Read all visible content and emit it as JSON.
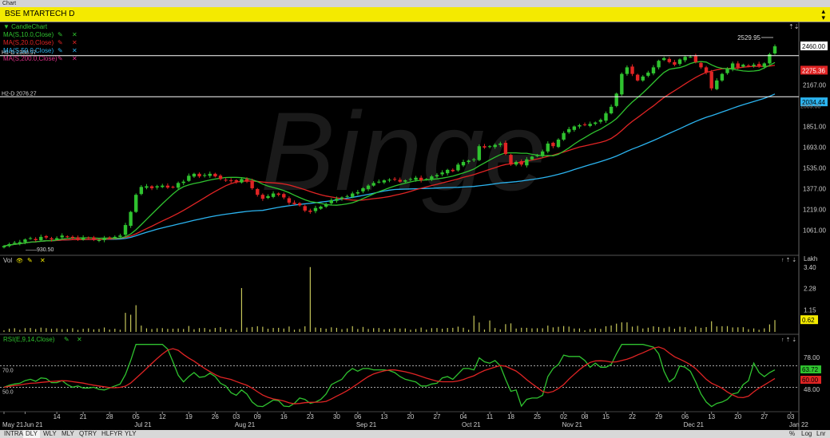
{
  "window": {
    "title": "Chart",
    "chart_title": "BSE MTARTECH D"
  },
  "panels": {
    "price": {
      "label": "CandleChart",
      "indicators": [
        {
          "label": "MA(S,10.0,Close)",
          "color": "#2fc22f"
        },
        {
          "label": "MA(S,20.0,Close)",
          "color": "#e02424"
        },
        {
          "label": "MA(S,50.0,Close)",
          "color": "#2bb4f0"
        },
        {
          "label": "MA(S,200.0,Close)",
          "color": "#e0308a"
        }
      ],
      "hline_labels": [
        "H1-D 2388.97",
        "H2-D 2076.27"
      ],
      "annotations": {
        "high": "2529.95",
        "low": "930.50"
      },
      "price_tags": [
        "2460.00",
        "2275.36",
        "2034.44"
      ]
    },
    "volume": {
      "label": "Vol",
      "unit": "Lakh",
      "last_tag": "0.62"
    },
    "rsi": {
      "label": "RSI(E,9,14,Close)",
      "levels": [
        "70.0",
        "50.0"
      ],
      "tags": [
        "63.72",
        "60.00"
      ]
    }
  },
  "bottom_tabs": [
    "INTRA",
    "DLY",
    "WLY",
    "MLY",
    "QTRY",
    "HLFYR",
    "YLY"
  ],
  "bottom_right": [
    "%",
    "Log",
    "Lnr"
  ],
  "watermark": "Binge",
  "chart_data": {
    "type": "candlestick",
    "title": "BSE MTARTECH D",
    "price_axis": {
      "ticks": [
        "2460.00",
        "2167.00",
        "2009.00",
        "1851.00",
        "1693.00",
        "1535.00",
        "1377.00",
        "1219.00",
        "1061.00"
      ],
      "range": [
        900,
        2600
      ]
    },
    "volume_axis": {
      "ticks": [
        "3.40",
        "2.28",
        "1.15"
      ],
      "unit": "Lakh"
    },
    "rsi_axis": {
      "ticks": [
        "78.00",
        "48.00"
      ],
      "levels": [
        70,
        50
      ]
    },
    "x_ticks": [
      {
        "day": "",
        "month": "May 21",
        "i": 0
      },
      {
        "day": "",
        "month": "Jun 21",
        "i": 4
      },
      {
        "day": "14",
        "month": "",
        "i": 10
      },
      {
        "day": "21",
        "month": "",
        "i": 15
      },
      {
        "day": "28",
        "month": "",
        "i": 20
      },
      {
        "day": "05",
        "month": "Jul 21",
        "i": 25
      },
      {
        "day": "12",
        "month": "",
        "i": 30
      },
      {
        "day": "19",
        "month": "",
        "i": 35
      },
      {
        "day": "26",
        "month": "",
        "i": 40
      },
      {
        "day": "03",
        "month": "Aug 21",
        "i": 44
      },
      {
        "day": "09",
        "month": "",
        "i": 48
      },
      {
        "day": "16",
        "month": "",
        "i": 53
      },
      {
        "day": "23",
        "month": "",
        "i": 58
      },
      {
        "day": "30",
        "month": "",
        "i": 63
      },
      {
        "day": "06",
        "month": "Sep 21",
        "i": 67
      },
      {
        "day": "13",
        "month": "",
        "i": 72
      },
      {
        "day": "20",
        "month": "",
        "i": 77
      },
      {
        "day": "27",
        "month": "",
        "i": 82
      },
      {
        "day": "04",
        "month": "Oct 21",
        "i": 87
      },
      {
        "day": "11",
        "month": "",
        "i": 92
      },
      {
        "day": "18",
        "month": "",
        "i": 96
      },
      {
        "day": "25",
        "month": "",
        "i": 101
      },
      {
        "day": "02",
        "month": "Nov 21",
        "i": 106
      },
      {
        "day": "08",
        "month": "",
        "i": 110
      },
      {
        "day": "15",
        "month": "",
        "i": 114
      },
      {
        "day": "22",
        "month": "",
        "i": 119
      },
      {
        "day": "29",
        "month": "",
        "i": 124
      },
      {
        "day": "06",
        "month": "Dec 21",
        "i": 129
      },
      {
        "day": "13",
        "month": "",
        "i": 134
      },
      {
        "day": "20",
        "month": "",
        "i": 139
      },
      {
        "day": "27",
        "month": "",
        "i": 144
      },
      {
        "day": "03",
        "month": "Jan 22",
        "i": 149
      }
    ],
    "close": [
      940,
      955,
      965,
      970,
      990,
      1000,
      985,
      1010,
      1005,
      990,
      1000,
      1020,
      1010,
      1000,
      995,
      1005,
      1000,
      990,
      985,
      1000,
      1005,
      1010,
      1020,
      1100,
      1200,
      1330,
      1390,
      1395,
      1380,
      1395,
      1400,
      1385,
      1390,
      1420,
      1430,
      1475,
      1490,
      1470,
      1480,
      1490,
      1470,
      1450,
      1440,
      1435,
      1430,
      1450,
      1430,
      1380,
      1330,
      1300,
      1320,
      1340,
      1330,
      1310,
      1270,
      1260,
      1250,
      1210,
      1200,
      1230,
      1240,
      1260,
      1290,
      1300,
      1310,
      1320,
      1340,
      1350,
      1380,
      1400,
      1420,
      1430,
      1440,
      1445,
      1450,
      1430,
      1440,
      1450,
      1460,
      1440,
      1450,
      1470,
      1480,
      1500,
      1520,
      1510,
      1560,
      1580,
      1590,
      1600,
      1700,
      1690,
      1700,
      1710,
      1720,
      1640,
      1560,
      1580,
      1560,
      1600,
      1620,
      1630,
      1660,
      1720,
      1700,
      1750,
      1800,
      1830,
      1850,
      1860,
      1860,
      1870,
      1880,
      1900,
      1950,
      2000,
      2100,
      2250,
      2300,
      2250,
      2200,
      2230,
      2260,
      2300,
      2350,
      2370,
      2340,
      2320,
      2360,
      2380,
      2380,
      2340,
      2300,
      2260,
      2140,
      2200,
      2250,
      2290,
      2330,
      2300,
      2320,
      2310,
      2320,
      2310,
      2330,
      2400,
      2460
    ]
  }
}
